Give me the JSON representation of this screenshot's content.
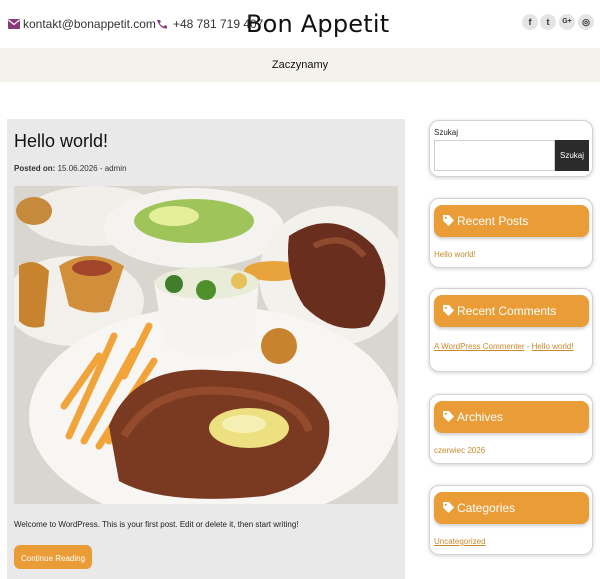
{
  "header": {
    "email": "kontakt@bonappetit.com",
    "phone": "+48 781 719 407",
    "brand": "Bon Appetit",
    "social": [
      {
        "icon": "facebook-icon",
        "glyph": "f"
      },
      {
        "icon": "twitter-icon",
        "glyph": "t"
      },
      {
        "icon": "google-plus-icon",
        "glyph": "G+"
      },
      {
        "icon": "instagram-icon",
        "glyph": "◎"
      }
    ]
  },
  "nav": {
    "items": [
      "Zaczynamy"
    ]
  },
  "post": {
    "title": "Hello world!",
    "meta_label": "Posted on:",
    "date": "15.06.2026",
    "separator": " - ",
    "author": "admin",
    "excerpt": "Welcome to WordPress. This is your first post. Edit or delete it, then start writing!",
    "continue": "Continue Reading"
  },
  "sidebar": {
    "search": {
      "label": "Szukaj",
      "placeholder": "",
      "button": "Szukaj"
    },
    "recent_posts": {
      "title": "Recent Posts",
      "items": [
        "Hello world!"
      ]
    },
    "recent_comments": {
      "title": "Recent Comments",
      "author": "A WordPress Commenter",
      "on": " - ",
      "post": "Hello world!"
    },
    "archives": {
      "title": "Archives",
      "items": [
        "czerwiec 2026"
      ]
    },
    "categories": {
      "title": "Categories",
      "items": [
        "Uncategorized"
      ]
    }
  },
  "colors": {
    "accent": "#ea9d36",
    "nav_bg": "#f5f2ec",
    "post_bg": "#e9e9e9",
    "search_button": "#2b2b2b",
    "icon_purple": "#8a3a7a"
  }
}
